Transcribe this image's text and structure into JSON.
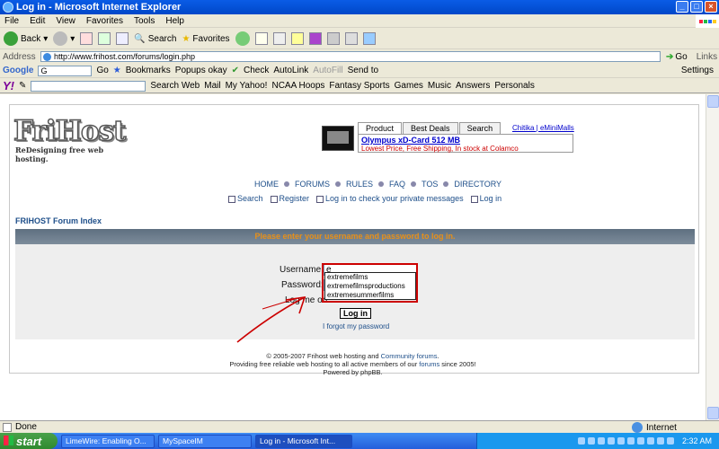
{
  "window": {
    "title": "Log in - Microsoft Internet Explorer",
    "min": "_",
    "max": "□",
    "close": "×"
  },
  "menu": [
    "File",
    "Edit",
    "View",
    "Favorites",
    "Tools",
    "Help"
  ],
  "toolbar": {
    "back": "Back",
    "search": "Search",
    "favorites": "Favorites"
  },
  "address": {
    "label": "Address",
    "url": "http://www.frihost.com/forums/login.php",
    "go": "Go",
    "links": "Links"
  },
  "google_bar": {
    "logo": "Google",
    "g": "G",
    "go": "Go",
    "bookmarks": "Bookmarks",
    "popups": "Popups okay",
    "check": "Check",
    "autolink": "AutoLink",
    "autofill": "AutoFill",
    "sendto": "Send to",
    "settings": "Settings"
  },
  "yahoo_bar": {
    "logo": "Y!",
    "searchweb": "Search Web",
    "mail": "Mail",
    "myyahoo": "My Yahoo!",
    "ncaa": "NCAA Hoops",
    "fantasy": "Fantasy Sports",
    "games": "Games",
    "music": "Music",
    "answers": "Answers",
    "personals": "Personals"
  },
  "logo": {
    "name": "FriHost",
    "tagline": "ReDesigning free web hosting."
  },
  "ad": {
    "tabs": [
      "Product",
      "Best Deals",
      "Search"
    ],
    "title": "Olympus xD-Card 512 MB",
    "subtitle": "Lowest Price, Free Shipping, In stock at Colamco",
    "chitika": "Chitika | eMiniMalls"
  },
  "nav": [
    "HOME",
    "FORUMS",
    "RULES",
    "FAQ",
    "TOS",
    "DIRECTORY"
  ],
  "subnav": [
    "Search",
    "Register",
    "Log in to check your private messages",
    "Log in"
  ],
  "forum_index": "FRIHOST Forum Index",
  "login": {
    "banner": "Please enter your username and password to log in.",
    "username_label": "Username:",
    "username_value": "e",
    "password_label": "Password:",
    "remember_label": "Log me on",
    "button": "Log in",
    "forgot": "I forgot my password",
    "autocomplete": [
      "extremefilms",
      "extremefilmsproductions",
      "extremesummerfilms"
    ]
  },
  "footer": {
    "line1_pre": "© 2005-2007 Frihost web hosting and ",
    "line1_link": "Community forums",
    "line1_post": ".",
    "line2_pre": "Providing free reliable web hosting to all active members of our ",
    "line2_link": "forums",
    "line2_post": " since 2005!",
    "line3": "Powered by phpBB."
  },
  "status": {
    "text": "Done",
    "zone": "Internet"
  },
  "taskbar": {
    "start": "start",
    "tasks": [
      "LimeWire: Enabling O...",
      "MySpaceIM",
      "Log in - Microsoft Int..."
    ],
    "clock": "2:32 AM"
  },
  "colors": {
    "accent": "#0a5ce6",
    "banner_text": "#e89018",
    "link": "#1e4f8a",
    "highlight": "#cc0000"
  }
}
